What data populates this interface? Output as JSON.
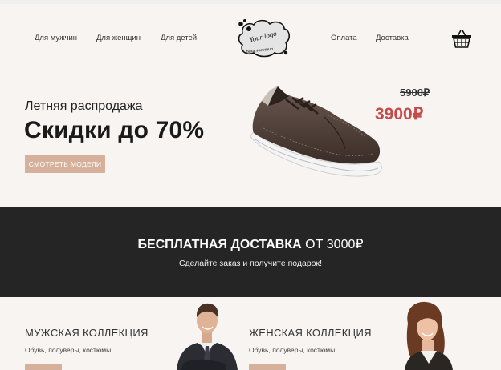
{
  "nav": {
    "left": [
      "Для мужчин",
      "Для женщин",
      "Для детей"
    ],
    "right": [
      "Оплата",
      "Доставка"
    ]
  },
  "logo": {
    "line1": "Your logo",
    "line2": "Ваш логотип"
  },
  "hero": {
    "subtitle": "Летняя распродажа",
    "title": "Скидки до 70%",
    "button": "СМОТРЕТЬ МОДЕЛИ",
    "old_price": "5900₽",
    "new_price": "3900₽"
  },
  "promo": {
    "bold": "БЕСПЛАТНАЯ ДОСТАВКА",
    "rest": " ОТ 3000₽",
    "sub": "Сделайте заказ и получите подарок!"
  },
  "collections": [
    {
      "title": "МУЖСКАЯ КОЛЛЕКЦИЯ",
      "sub": "Обувь, полуверы, костюмы"
    },
    {
      "title": "ЖЕНСКАЯ КОЛЛЕКЦИЯ",
      "sub": "Обувь, полуверы, костюмы"
    }
  ],
  "icons": {
    "cart": "shopping-basket-icon"
  },
  "colors": {
    "accent": "#d5b09a",
    "price": "#c64a4a",
    "band": "#252525",
    "bg": "#f8f4f1"
  }
}
